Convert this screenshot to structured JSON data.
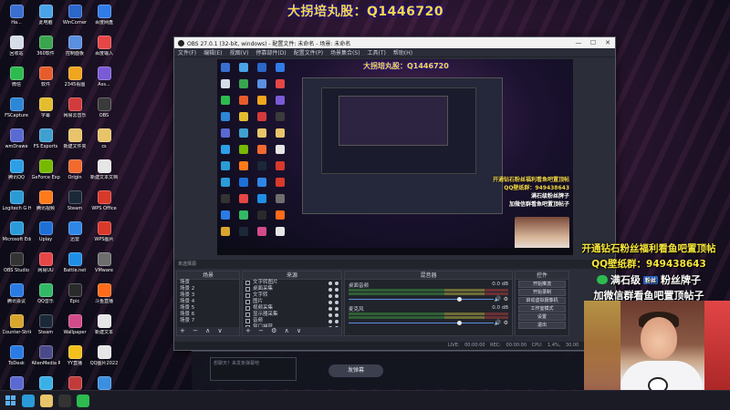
{
  "stream_title": "大拐培丸股：Q1446720",
  "desktop": {
    "icons": [
      {
        "label": "Ha...",
        "color": "#3a6fd0"
      },
      {
        "label": "此电脑",
        "color": "#4aa3e6"
      },
      {
        "label": "WinCorner",
        "color": "#2b66c9"
      },
      {
        "label": "百度网盘",
        "color": "#2f7be8"
      },
      {
        "label": "回收站",
        "color": "#d7dde8"
      },
      {
        "label": "360软件",
        "color": "#3aa54f"
      },
      {
        "label": "控制面板",
        "color": "#5b8fe0"
      },
      {
        "label": "百度输入",
        "color": "#e64646"
      },
      {
        "label": "微信",
        "color": "#2dbb4f"
      },
      {
        "label": "软件",
        "color": "#e65c2d"
      },
      {
        "label": "2345看图",
        "color": "#f0a51e"
      },
      {
        "label": "Ass...",
        "color": "#7a5ad6"
      },
      {
        "label": "FSCapture",
        "color": "#2d86d6"
      },
      {
        "label": "字幕",
        "color": "#e2bd2f"
      },
      {
        "label": "网易云音乐",
        "color": "#d23b3b"
      },
      {
        "label": "OBS",
        "color": "#3a3a3a"
      },
      {
        "label": "wmDrawe",
        "color": "#5a6ad0"
      },
      {
        "label": "FS Exports",
        "color": "#3fa0d0"
      },
      {
        "label": "新建文件夹",
        "color": "#e8c56a"
      },
      {
        "label": "cs",
        "color": "#e8c56a"
      },
      {
        "label": "腾讯QQ",
        "color": "#2d9fe6"
      },
      {
        "label": "GeForce Experience",
        "color": "#76b900"
      },
      {
        "label": "Origin",
        "color": "#f26a2e"
      },
      {
        "label": "新建文本文档",
        "color": "#e6e6e6"
      },
      {
        "label": "Logitech G HUB",
        "color": "#2b9bd6"
      },
      {
        "label": "腾讯视频",
        "color": "#ff7a1a"
      },
      {
        "label": "Steam",
        "color": "#1b2838"
      },
      {
        "label": "WPS Office",
        "color": "#d8392b"
      },
      {
        "label": "Microsoft Edge",
        "color": "#2a9bd8"
      },
      {
        "label": "Uplay",
        "color": "#1e6fd6"
      },
      {
        "label": "迅雷",
        "color": "#2f86e6"
      },
      {
        "label": "WPS图片",
        "color": "#d8392b"
      },
      {
        "label": "OBS Studio",
        "color": "#333333"
      },
      {
        "label": "网易UU",
        "color": "#e64646"
      },
      {
        "label": "Battle.net",
        "color": "#1f8fe6"
      },
      {
        "label": "VMware",
        "color": "#6e6e6e"
      },
      {
        "label": "腾讯会议",
        "color": "#2a7be4"
      },
      {
        "label": "QQ音乐",
        "color": "#33b866"
      },
      {
        "label": "Epic",
        "color": "#2a2a2a"
      },
      {
        "label": "斗鱼直播",
        "color": "#ff6b1a"
      },
      {
        "label": "Counter-Strike",
        "color": "#d8a52d"
      },
      {
        "label": "Steam",
        "color": "#1b2838"
      },
      {
        "label": "Wallpaper",
        "color": "#d24b8a"
      },
      {
        "label": "新建文本",
        "color": "#e6e6e6"
      },
      {
        "label": "ToDesk",
        "color": "#2a7be4"
      },
      {
        "label": "AlienMedia RCentral",
        "color": "#4a4a8a"
      },
      {
        "label": "YY直播",
        "color": "#f3c11b"
      },
      {
        "label": "QQ图片2022",
        "color": "#e6e6e6"
      },
      {
        "label": "rcs.ssx",
        "color": "#5a6ad0"
      },
      {
        "label": "MuMu模拟器",
        "color": "#3bb0e6"
      },
      {
        "label": "javk",
        "color": "#c23b3b"
      },
      {
        "label": "无标题",
        "color": "#3a8fe0"
      }
    ]
  },
  "obs": {
    "window_title": "OBS 27.0.1 (32-bit, windows) - 配置文件: 未命名 - 场景: 未命名",
    "window_controls": [
      "—",
      "☐",
      "✕"
    ],
    "menu": [
      "文件(F)",
      "编辑(E)",
      "视图(V)",
      "停靠部件(D)",
      "配置文件(P)",
      "场景集合(S)",
      "工具(T)",
      "帮助(H)"
    ],
    "preview_title": "大拐培丸股：Q1446720",
    "preview_overlay": {
      "line1": "开通钻石粉丝福利看鱼吧置顶帖",
      "line2": "QQ壁纸群：949438643",
      "line3": "满石级粉丝牌子",
      "line4": "加微信群看鱼吧置顶帖子"
    },
    "status_mini": "未选择源",
    "scenes": {
      "header": "场景",
      "items": [
        "场景",
        "场景 2",
        "场景 3",
        "场景 4",
        "场景 5",
        "场景 6",
        "场景 7"
      ],
      "footer": "+ − ∧ ∨"
    },
    "sources": {
      "header": "来源",
      "items": [
        "文字转图片",
        "桌面采集",
        "文字转",
        "图片",
        "视频采集",
        "显示器采集",
        "音频",
        "窗口捕获"
      ],
      "footer": "+ − ⚙ ∧ ∨"
    },
    "mixer": {
      "header": "混音器",
      "tracks": [
        {
          "name": "桌面音频",
          "db": "0.0 dB"
        },
        {
          "name": "麦克风",
          "db": "0.0 dB"
        }
      ]
    },
    "controls": {
      "header": "控件",
      "buttons": [
        "开始推流",
        "开始录制",
        "启动虚拟摄像机",
        "工作室模式",
        "设置",
        "退出"
      ]
    },
    "statusbar": "LIVE: 00:00:00   REC: 00:00:00   CPU: 1.4%, 30.00 fps"
  },
  "overlay": {
    "line1": "开通钻石粉丝福利看鱼吧置顶帖",
    "line2": "QQ壁纸群：949438643",
    "line3": "满石级",
    "fan_tag": "粉丝",
    "line3_tail": "粉丝牌子",
    "line4": "加微信群看鱼吧置顶帖子"
  },
  "chat": {
    "hint": "想聊天？来发条弹幕吧",
    "send_label": "发弹幕"
  }
}
